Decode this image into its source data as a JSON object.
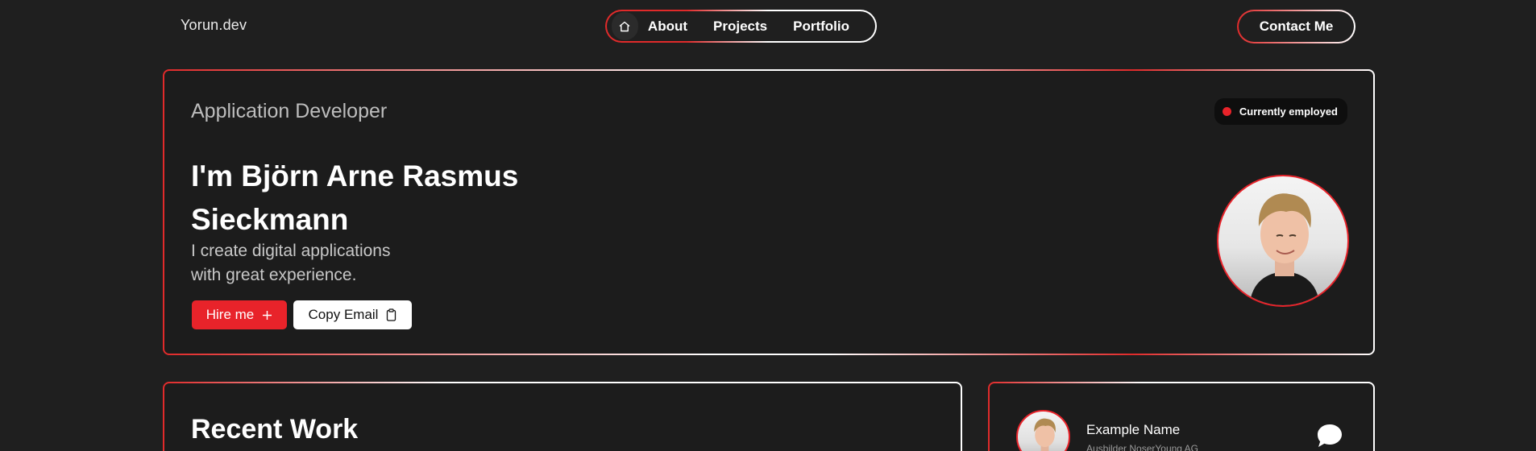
{
  "header": {
    "logo": "Yorun.dev",
    "nav": {
      "home_icon": "home-icon",
      "items": [
        {
          "label": "About"
        },
        {
          "label": "Projects"
        },
        {
          "label": "Portfolio"
        }
      ]
    },
    "contact_label": "Contact Me"
  },
  "hero": {
    "role": "Application Developer",
    "status": "Currently employed",
    "headline_line1": "I'm Björn Arne Rasmus",
    "headline_line2": "Sieckmann",
    "tagline_line1": "I create digital applications",
    "tagline_line2": "with great experience.",
    "hire_label": "Hire me",
    "copy_email_label": "Copy Email",
    "avatar": "portrait-photo"
  },
  "recent_work": {
    "title": "Recent Work"
  },
  "testimonial": {
    "name": "Example Name",
    "role": "Ausbilder NoserYoung AG",
    "icon": "chat-bubble-icon"
  },
  "colors": {
    "background": "#1f1f1f",
    "accent": "#e8232a",
    "text": "#ffffff",
    "muted": "#bdbdbd"
  }
}
